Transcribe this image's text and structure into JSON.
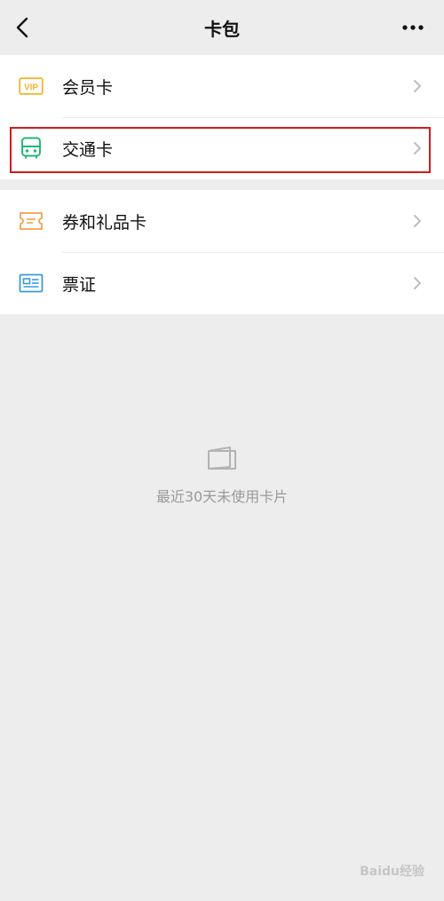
{
  "nav": {
    "title": "卡包"
  },
  "menu": {
    "group1": [
      {
        "label": "会员卡",
        "icon": "vip-card-icon"
      },
      {
        "label": "交通卡",
        "icon": "bus-card-icon"
      }
    ],
    "group2": [
      {
        "label": "券和礼品卡",
        "icon": "coupon-icon"
      },
      {
        "label": "票证",
        "icon": "id-ticket-icon"
      }
    ]
  },
  "empty_state": {
    "text": "最近30天未使用卡片",
    "icon": "wallet-icon"
  },
  "watermark": {
    "text": "Baidu经验"
  },
  "colors": {
    "background": "#ededed",
    "highlight": "#d21c1c",
    "vip": "#f2b530",
    "bus": "#1fb874",
    "coupon": "#f2a24a",
    "ticket": "#3a9bd6"
  }
}
